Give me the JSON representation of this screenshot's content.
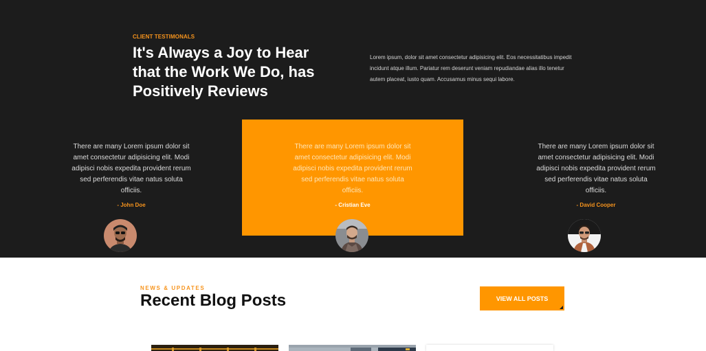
{
  "testimonials": {
    "eyebrow": "CLIENT TESTIMONALS",
    "heading": "It's Always a Joy to Hear that the Work We Do, has Positively Reviews",
    "intro": "Lorem ipsum, dolor sit amet consectetur adipisicing elit. Eos necessitatibus impedit incidunt atque illum. Pariatur rem deserunt veniam repudiandae alias illo tenetur autem placeat, iusto quam. Accusamus minus sequi labore.",
    "items": [
      {
        "quote": "There are many Lorem ipsum dolor sit amet consectetur adipisicing elit. Modi adipisci nobis expedita provident rerum sed perferendis vitae natus soluta officiis.",
        "author": "- John Doe"
      },
      {
        "quote": "There are many Lorem ipsum dolor sit amet consectetur adipisicing elit. Modi adipisci nobis expedita provident rerum sed perferendis vitae natus soluta officiis.",
        "author": "- Cristian Eve"
      },
      {
        "quote": "There are many Lorem ipsum dolor sit amet consectetur adipisicing elit. Modi adipisci nobis expedita provident rerum sed perferendis vitae natus soluta officiis.",
        "author": "- David Cooper"
      }
    ]
  },
  "blog": {
    "eyebrow": "NEWS & UPDATES",
    "title": "Recent Blog Posts",
    "view_all_label": "VIEW ALL POSTS"
  },
  "colors": {
    "accent": "#ff9600",
    "dark_bg": "#1c1c1c"
  }
}
